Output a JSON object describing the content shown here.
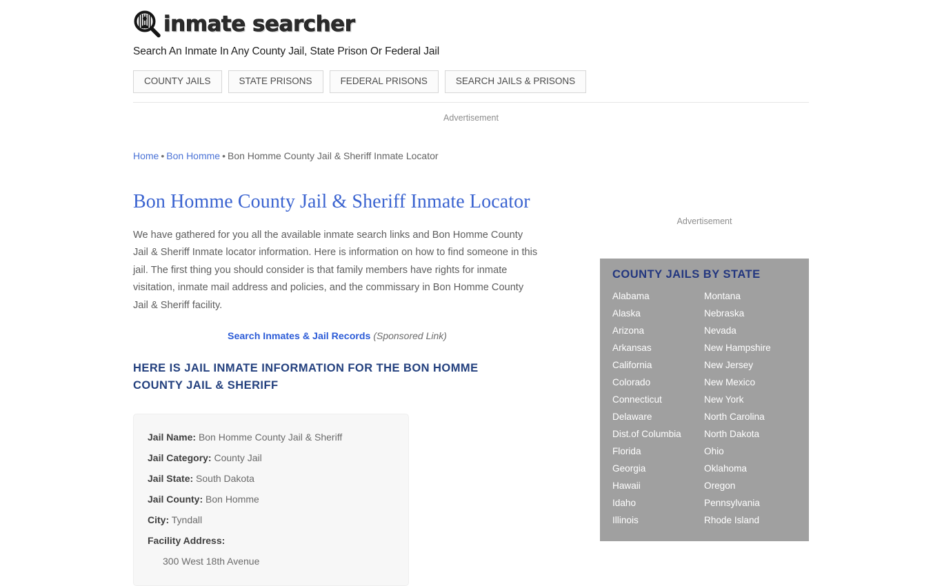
{
  "site": {
    "logo_text": "inmate searcher",
    "logo_icon": "magnifier-jail-icon",
    "tagline": "Search An Inmate In Any County Jail, State Prison Or Federal Jail"
  },
  "nav": {
    "items": [
      {
        "label": "COUNTY JAILS"
      },
      {
        "label": "STATE PRISONS"
      },
      {
        "label": "FEDERAL PRISONS"
      },
      {
        "label": "SEARCH JAILS & PRISONS"
      }
    ]
  },
  "ads": {
    "top_label": "Advertisement",
    "sidebar_label": "Advertisement"
  },
  "breadcrumb": {
    "home": "Home",
    "county": "Bon Homme",
    "current": "Bon Homme County Jail & Sheriff Inmate Locator",
    "separator": "•"
  },
  "main": {
    "title": "Bon Homme County Jail & Sheriff Inmate Locator",
    "intro": "We have gathered for you all the available inmate search links and Bon Homme County Jail & Sheriff Inmate locator information. Here is information on how to find someone in this jail. The first thing you should consider is that family members have rights for inmate visitation, inmate mail address and policies, and the commissary in Bon Homme County Jail & Sheriff facility.",
    "sponsored_link": "Search Inmates & Jail Records",
    "sponsored_note": "(Sponsored Link)",
    "section_heading": "HERE IS JAIL INMATE INFORMATION FOR THE BON HOMME COUNTY JAIL & SHERIFF"
  },
  "info_box": {
    "rows": [
      {
        "label": "Jail Name:",
        "value": "Bon Homme County Jail & Sheriff"
      },
      {
        "label": "Jail Category:",
        "value": "County Jail"
      },
      {
        "label": "Jail State:",
        "value": "South Dakota"
      },
      {
        "label": "Jail County:",
        "value": "Bon Homme"
      },
      {
        "label": "City:",
        "value": "Tyndall"
      }
    ],
    "address_label": "Facility Address:",
    "address_line1": "300 West 18th Avenue"
  },
  "sidebar": {
    "title": "COUNTY JAILS BY STATE",
    "col_left": [
      "Alabama",
      "Alaska",
      "Arizona",
      "Arkansas",
      "California",
      "Colorado",
      "Connecticut",
      "Delaware",
      "Dist.of Columbia",
      "Florida",
      "Georgia",
      "Hawaii",
      "Idaho",
      "Illinois"
    ],
    "col_right": [
      "Montana",
      "Nebraska",
      "Nevada",
      "New Hampshire",
      "New Jersey",
      "New Mexico",
      "New York",
      "North Carolina",
      "North Dakota",
      "Ohio",
      "Oklahoma",
      "Oregon",
      "Pennsylvania",
      "Rhode Island"
    ]
  },
  "colors": {
    "link_blue": "#4a72d6",
    "title_blue": "#3a63d0",
    "heading_navy": "#23407e",
    "sidebar_bg": "#a0a0a0",
    "info_box_bg": "#f7f7f7"
  }
}
